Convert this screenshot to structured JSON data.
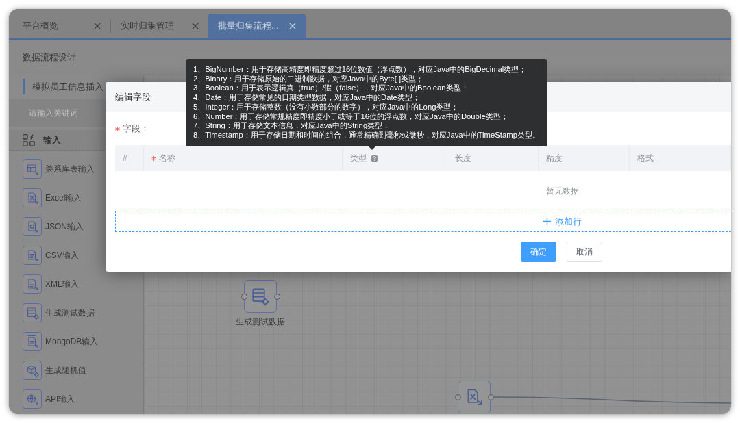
{
  "tabs": [
    {
      "label": "平台概览",
      "selected": false
    },
    {
      "label": "实时归集管理",
      "selected": false
    },
    {
      "label": "批量归集流程...",
      "selected": true
    }
  ],
  "page_title": "数据流程设计",
  "sidebar": {
    "flow_name": "模拟员工信息插入",
    "search": {
      "placeholder": "请输入关键词"
    },
    "section": {
      "title": "输入",
      "items": [
        {
          "label": "关系库表输入",
          "kind": "table"
        },
        {
          "label": "Excel输入",
          "kind": "excel"
        },
        {
          "label": "JSON输入",
          "kind": "json"
        },
        {
          "label": "CSV输入",
          "kind": "csv"
        },
        {
          "label": "XML输入",
          "kind": "xml"
        },
        {
          "label": "生成测试数据",
          "kind": "testdata"
        },
        {
          "label": "MongoDB输入",
          "kind": "mongodb"
        },
        {
          "label": "生成随机值",
          "kind": "random"
        },
        {
          "label": "API输入",
          "kind": "api"
        }
      ]
    }
  },
  "canvas": {
    "nodes": [
      {
        "label": "生成测试数据",
        "kind": "testdata"
      },
      {
        "kind": "excel"
      }
    ]
  },
  "dialog": {
    "title": "编辑字段",
    "field": {
      "label": "字段：",
      "required": true
    },
    "table": {
      "columns": [
        {
          "label": "#",
          "required": false,
          "help": false
        },
        {
          "label": "名称",
          "required": true,
          "help": false
        },
        {
          "label": "类型",
          "required": false,
          "help": true
        },
        {
          "label": "长度",
          "required": false,
          "help": false
        },
        {
          "label": "精度",
          "required": false,
          "help": false
        },
        {
          "label": "格式",
          "required": false,
          "help": false
        }
      ],
      "empty_text": "暂无数据",
      "add_row": "添加行"
    },
    "buttons": [
      {
        "label": "确定",
        "kind": "primary"
      },
      {
        "label": "取消",
        "kind": "default"
      }
    ]
  },
  "tooltip": {
    "lines": [
      "1、BigNumber：用于存储高精度即精度超过16位数值（浮点数），对应Java中的BigDecimal类型；",
      "2、Binary：用于存储原始的二进制数据，对应Java中的Byte[ ]类型；",
      "3、Boolean：用于表示逻辑真（true）/假（false），对应Java中的Boolean类型；",
      "4、Date：用于存储常见的日期类型数据，对应Java中的Date类型；",
      "5、Integer：用于存储整数（没有小数部分的数字），对应Java中的Long类型；",
      "6、Number：用于存储常规精度即精度小于或等于16位的浮点数，对应Java中的Double类型；",
      "7、String：用于存储文本信息，对应Java中的String类型；",
      "8、Timestamp：用于存储日期和时间的组合，通常精确到毫秒或微秒，对应Java中的TimeStamp类型。"
    ]
  }
}
